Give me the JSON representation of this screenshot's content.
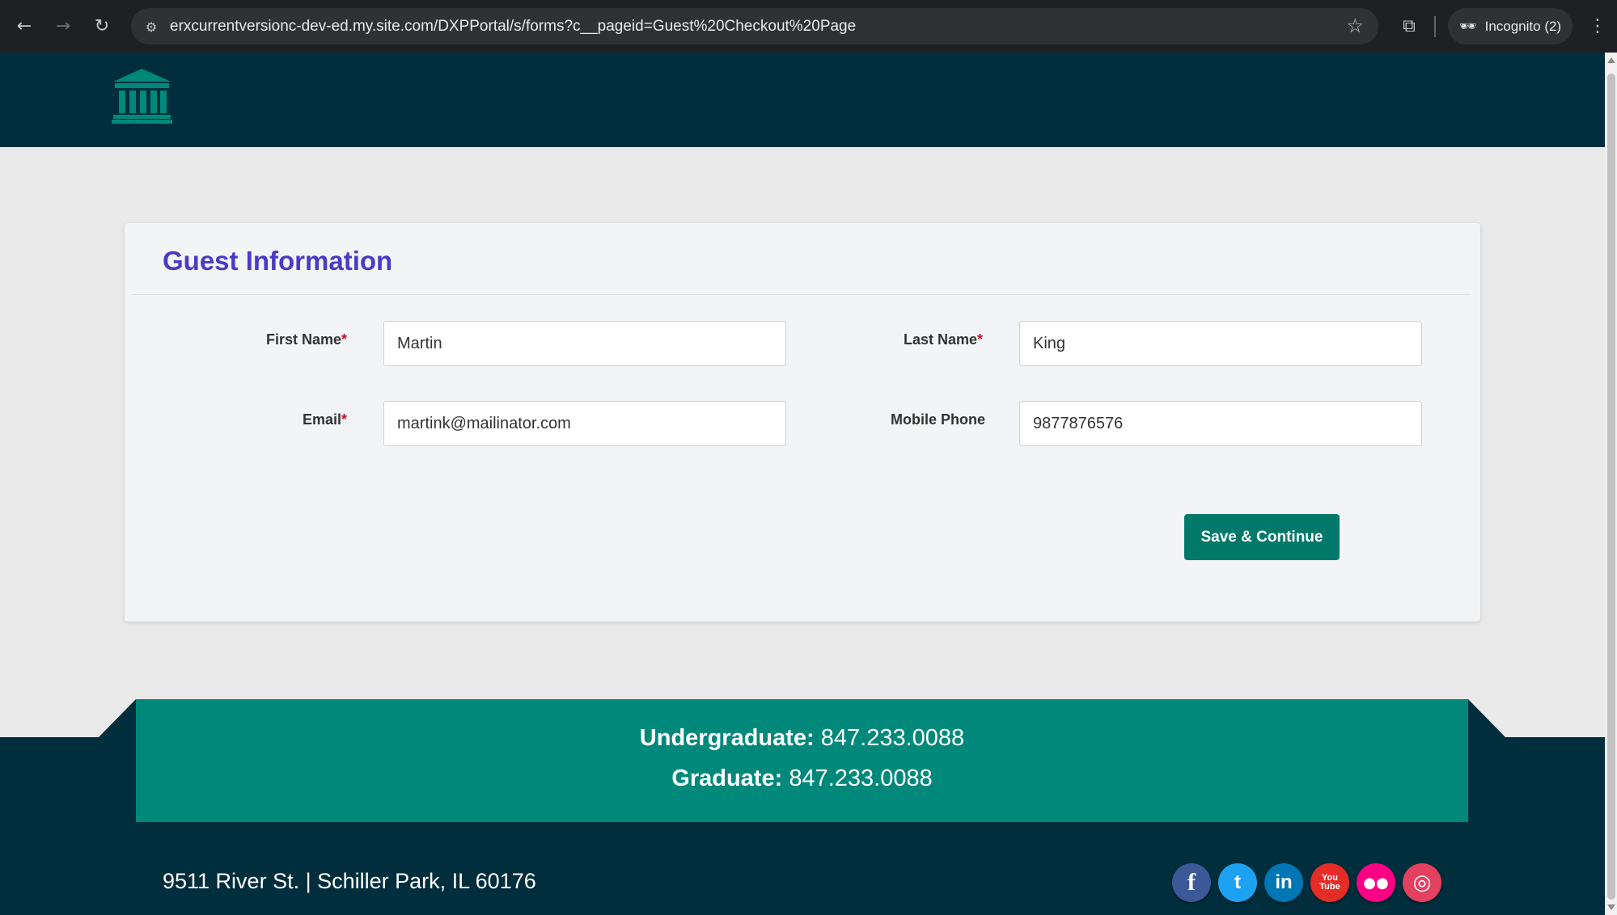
{
  "browser": {
    "url": "erxcurrentversionc-dev-ed.my.site.com/DXPPortal/s/forms?c__pageid=Guest%20Checkout%20Page",
    "incognito_label": "Incognito (2)"
  },
  "form": {
    "title": "Guest Information",
    "required_marker": "*",
    "first_name": {
      "label": "First Name",
      "value": "Martin"
    },
    "last_name": {
      "label": "Last Name",
      "value": "King"
    },
    "email": {
      "label": "Email",
      "value": "martink@mailinator.com"
    },
    "mobile_phone": {
      "label": "Mobile Phone",
      "value": "9877876576"
    },
    "submit_label": "Save & Continue"
  },
  "footer": {
    "undergrad_label": "Undergraduate:",
    "undergrad_phone": "847.233.0088",
    "grad_label": "Graduate:",
    "grad_phone": "847.233.0088",
    "address": "9511 River St. | Schiller Park, IL 60176",
    "social": [
      {
        "name": "facebook",
        "glyph": "f",
        "color": "#3b5998"
      },
      {
        "name": "twitter",
        "glyph": "t",
        "color": "#1da1f2"
      },
      {
        "name": "linkedin",
        "glyph": "in",
        "color": "#0077b5"
      },
      {
        "name": "youtube",
        "glyph": "You Tube",
        "color": "#e52d27"
      },
      {
        "name": "flickr",
        "glyph": "●●",
        "color": "#ff0084"
      },
      {
        "name": "instagram",
        "glyph": "◎",
        "color": "#e4405f"
      }
    ]
  },
  "colors": {
    "header_bg": "#002e3d",
    "accent_teal": "#00796b",
    "band_teal": "#00897b",
    "title_purple": "#4a3bc6",
    "required_red": "#c8102e"
  }
}
